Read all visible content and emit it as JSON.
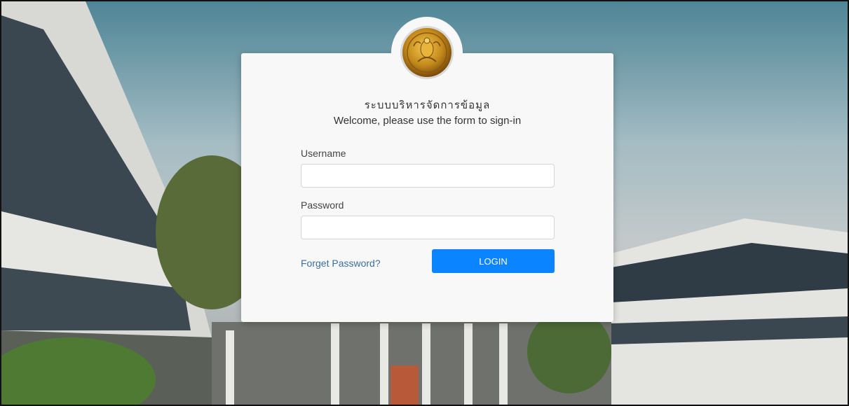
{
  "header": {
    "title_thai": "ระบบบริหารจัดการข้อมูล",
    "subtitle": "Welcome, please use the form to sign-in"
  },
  "form": {
    "username_label": "Username",
    "username_value": "",
    "password_label": "Password",
    "password_value": "",
    "forgot_label": "Forget Password?",
    "login_label": "LOGIN"
  },
  "colors": {
    "accent": "#0a84ff",
    "link": "#3a6ea5",
    "card": "#f8f8f8"
  },
  "icons": {
    "emblem": "royal-emblem-icon"
  }
}
